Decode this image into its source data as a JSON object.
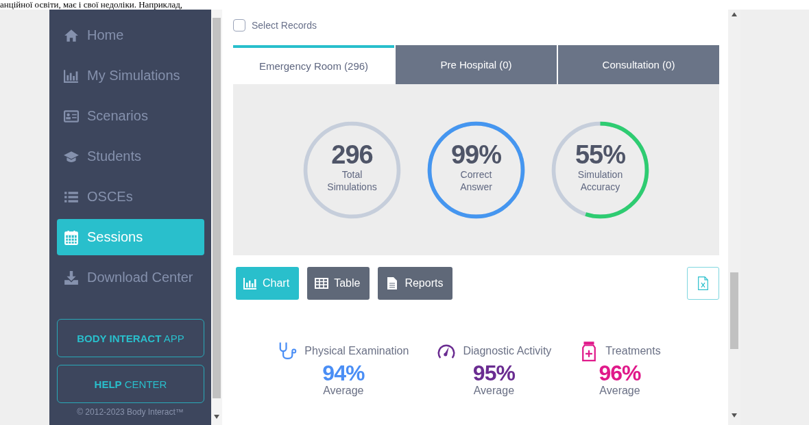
{
  "document_text": "анційної освіти, має і свої недоліки. Наприклад,",
  "sidebar": {
    "items": [
      {
        "label": "Home",
        "kind": "home",
        "selected": false
      },
      {
        "label": "My Simulations",
        "kind": "chart",
        "selected": false
      },
      {
        "label": "Scenarios",
        "kind": "card",
        "selected": false
      },
      {
        "label": "Students",
        "kind": "cap",
        "selected": false
      },
      {
        "label": "OSCEs",
        "kind": "list",
        "selected": false
      },
      {
        "label": "Sessions",
        "kind": "calendar",
        "selected": true
      },
      {
        "label": "Download Center",
        "kind": "download",
        "selected": false
      }
    ],
    "buttons": [
      "**BODY INTERACT** APP",
      "**HELP** CENTER"
    ],
    "copyright": "© 2012-2023 Body Interact™"
  },
  "select_records": {
    "label": "Select Records",
    "checked": false
  },
  "tabs": [
    {
      "label": "Emergency Room (296)",
      "selected": true
    },
    {
      "label": "Pre Hospital (0)",
      "selected": false
    },
    {
      "label": "Consultation (0)",
      "selected": false
    }
  ],
  "stats": [
    {
      "value": "296",
      "label": "Total Simulations"
    },
    {
      "value": "99%",
      "label": "Correct Answer",
      "level": 1,
      "color": "#4596f0"
    },
    {
      "value": "55%",
      "label": "Simulation Accuracy",
      "level": 0.55,
      "color": "#2ecc71"
    }
  ],
  "view_buttons": [
    {
      "label": "Chart",
      "kind": "chart",
      "selected": true
    },
    {
      "label": "Table",
      "kind": "table",
      "selected": false
    },
    {
      "label": "Reports",
      "kind": "doc",
      "selected": false
    }
  ],
  "averages": [
    {
      "kind": "stethoscope",
      "title": "Physical Examination",
      "value": "94%",
      "label": "Average",
      "color": "#4a8ef5"
    },
    {
      "kind": "gauge",
      "title": "Diagnostic Activity",
      "value": "95%",
      "label": "Average",
      "color": "#6a2c91"
    },
    {
      "kind": "jar",
      "title": "Treatments",
      "value": "96%",
      "label": "Average",
      "color": "#e0198a"
    }
  ]
}
